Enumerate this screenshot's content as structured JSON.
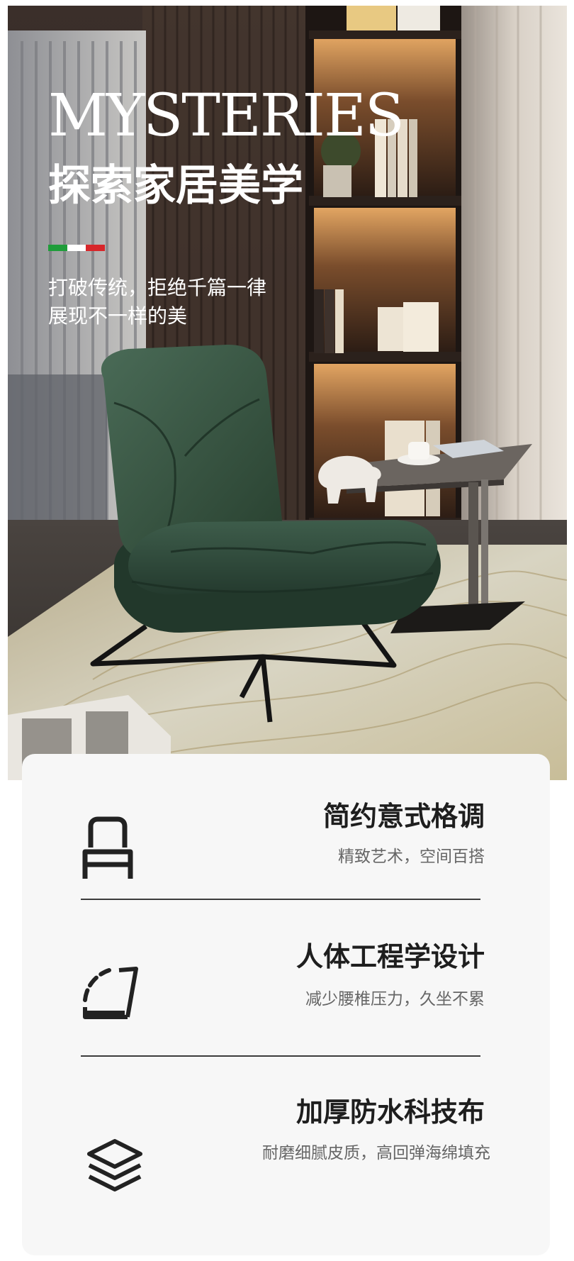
{
  "hero": {
    "title": "MYSTERIES",
    "subtitle": "探索家居美学",
    "flag_colors": [
      "#1f9d3a",
      "#ffffff",
      "#d7262a"
    ],
    "tagline_line1": "打破传统，拒绝千篇一律",
    "tagline_line2": "展现不一样的美"
  },
  "features": [
    {
      "icon": "armchair-icon",
      "title": "简约意式格调",
      "subtitle": "精致艺术，空间百搭"
    },
    {
      "icon": "ergonomic-backrest-icon",
      "title": "人体工程学设计",
      "subtitle": "减少腰椎压力，久坐不累"
    },
    {
      "icon": "fabric-layers-icon",
      "title": "加厚防水科技布",
      "subtitle": "耐磨细腻皮质，高回弹海绵填充"
    }
  ],
  "colors": {
    "chair_green": "#2f4a3b",
    "card_background": "#f7f7f7",
    "title_text": "#1e1e1e",
    "subtitle_text": "#666666"
  }
}
